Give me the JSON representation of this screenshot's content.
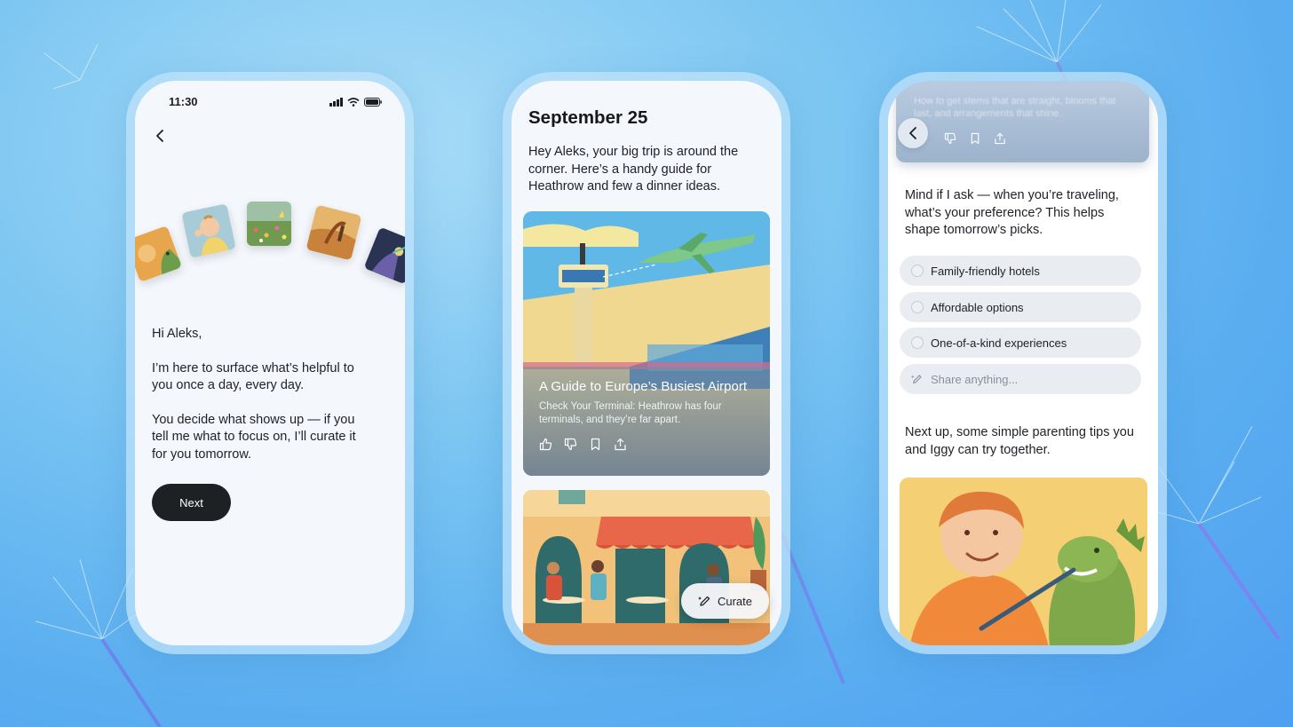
{
  "phone1": {
    "status_time": "11:30",
    "intro_hi": "Hi Aleks,",
    "intro_p1": "I’m here to surface what’s helpful to you once a day, every day.",
    "intro_p2": "You decide what shows up — if you tell me what to focus on, I’ll curate it for you tomorrow.",
    "next_label": "Next"
  },
  "phone2": {
    "date": "September 25",
    "greeting": "Hey Aleks, your big trip is around the corner.  Here’s a handy guide for Heathrow and few a dinner ideas.",
    "card1": {
      "title": "A Guide to Europe’s Busiest Airport",
      "description": "Check Your Terminal: Heathrow has four terminals, and they’re far apart."
    },
    "curate_label": "Curate"
  },
  "phone3": {
    "top_card_text": "How to get stems that are straight, blooms that last, and arrangements that shine.",
    "question": "Mind if I ask — when you’re traveling, what’s your preference? This helps shape tomorrow’s picks.",
    "options": [
      "Family-friendly hotels",
      "Affordable options",
      "One-of-a-kind experiences"
    ],
    "share_placeholder": "Share anything...",
    "next_up": "Next up, some simple  parenting tips you and Iggy can try together."
  },
  "colors": {
    "accent_dark": "#1d2124",
    "background": "#7cc6f2",
    "screen": "#f4f8fd"
  }
}
